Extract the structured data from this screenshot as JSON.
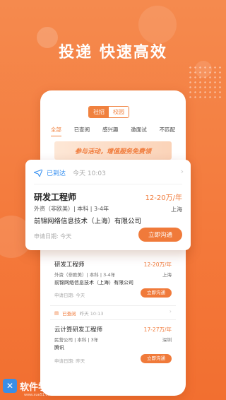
{
  "hero": {
    "title": "投递 快速高效"
  },
  "toggle": {
    "social": "社招",
    "campus": "校园"
  },
  "tabs": [
    "全部",
    "已查阅",
    "感兴趣",
    "邀面试",
    "不匹配"
  ],
  "banner": {
    "text": "参与活动，增值服务免费领"
  },
  "card": {
    "status": "已到达",
    "time": "今天 10:03",
    "title": "研发工程师",
    "salary": "12-20万/年",
    "meta": "外资（非欧美）| 本科 | 3-4年",
    "city": "上海",
    "company": "前锦网络信息技术（上海）有限公司",
    "date": "申请日期: 今天",
    "button": "立即沟通"
  },
  "item1": {
    "title": "研发工程师",
    "salary": "12-20万/年",
    "meta": "外资（非欧美）| 本科 | 3-4年",
    "city": "上海",
    "company": "前锦网络信息技术（上海）有限公司",
    "date": "申请日期: 今天",
    "button": "立即沟通"
  },
  "item2": {
    "status": "已查阅",
    "time": "昨天 10:13",
    "title": "云计算研发工程师",
    "salary": "17-27万/年",
    "meta": "民营公司 | 本科 | 3年",
    "city": "深圳",
    "company": "腾讯",
    "date": "申请日期: 昨天",
    "button": "立即沟通"
  },
  "watermark": {
    "name": "软件学堂",
    "url": "www.xue51.com"
  },
  "colors": {
    "accent": "#f07a3a",
    "reached": "#2f8cf0",
    "background": "#f47a3c"
  }
}
